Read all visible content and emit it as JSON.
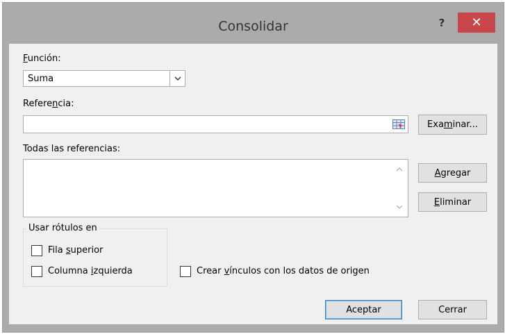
{
  "window": {
    "title": "Consolidar",
    "help_label": "?",
    "close_label": "✕"
  },
  "funcion": {
    "label_accel": "F",
    "label_rest": "unción:",
    "value": "Suma"
  },
  "referencia": {
    "label_pre": "Refere",
    "label_accel": "n",
    "label_post": "cia:",
    "value": "",
    "browse_pre": "Exa",
    "browse_accel": "m",
    "browse_post": "inar..."
  },
  "todas": {
    "label": "Todas las referencias:",
    "items": []
  },
  "buttons": {
    "agregar_accel": "A",
    "agregar_rest": "gregar",
    "eliminar_accel": "E",
    "eliminar_rest": "liminar",
    "aceptar": "Aceptar",
    "cerrar": "Cerrar"
  },
  "rotulos": {
    "group_label": "Usar rótulos en",
    "fila_pre": "Fila ",
    "fila_accel": "s",
    "fila_post": "uperior",
    "fila_checked": false,
    "col_pre": "Columna ",
    "col_accel": "i",
    "col_post": "zquierda",
    "col_checked": false
  },
  "vinculos": {
    "pre": "Crear ",
    "accel": "v",
    "post": "ínculos con los datos de origen",
    "checked": false
  }
}
